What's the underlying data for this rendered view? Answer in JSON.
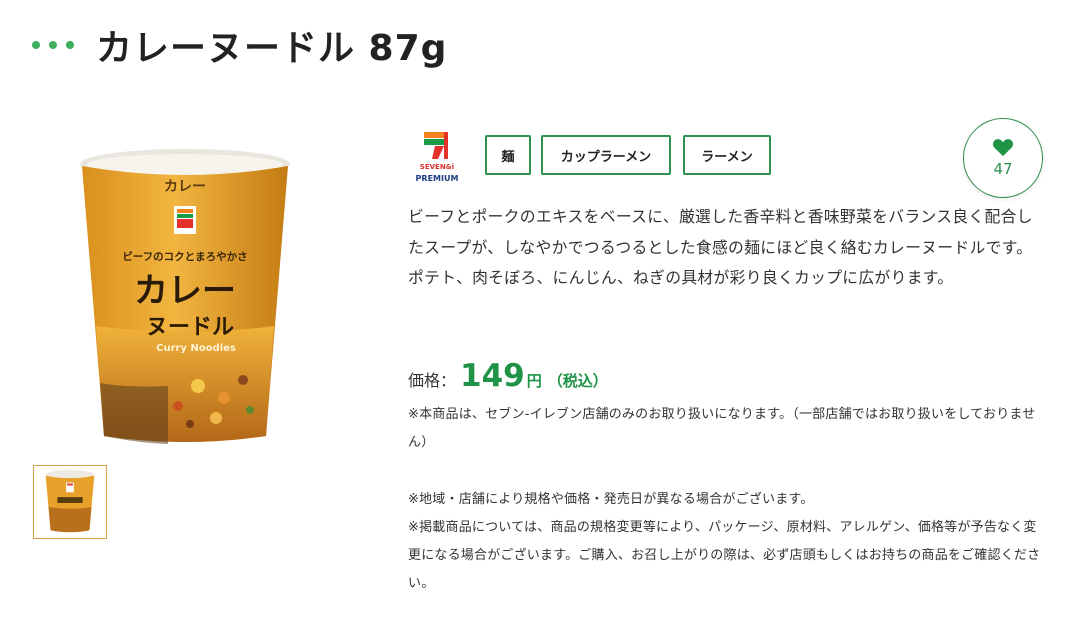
{
  "header": {
    "title": "カレーヌードル 87g"
  },
  "brand": {
    "logo_text_line1": "SEVEN&i",
    "logo_text_line2": "PREMIUM"
  },
  "tags": [
    {
      "label": "麺"
    },
    {
      "label": "カップラーメン"
    },
    {
      "label": "ラーメン"
    }
  ],
  "favorite": {
    "count": "47"
  },
  "description": "ビーフとポークのエキスをベースに、厳選した香辛料と香味野菜をバランス良く配合したスープが、しなやかでつるつるとした食感の麺にほど良く絡むカレーヌードルです。ポテト、肉そぼろ、にんじん、ねぎの具材が彩り良くカップに広がります。",
  "price": {
    "label": "価格：",
    "value": "149",
    "unit": "円",
    "tax": "（税込）"
  },
  "notes": {
    "store_only": "※本商品は、セブン-イレブン店舗のみのお取り扱いになります。（一部店舗ではお取り扱いをしておりません）",
    "region": "※地域・店舗により規格や価格・発売日が異なる場合がございます。",
    "listing": "※掲載商品については、商品の規格変更等により、パッケージ、原材料、アレルゲン、価格等が予告なく変更になる場合がございます。ご購入、お召し上がりの際は、必ず店頭もしくはお持ちの商品をご確認ください。"
  },
  "package": {
    "tagline": "ビーフのコクとまろやかさ",
    "name_line1": "カレー",
    "name_line2": "ヌードル",
    "english": "Curry Noodles"
  },
  "colors": {
    "accent_green": "#1f9346",
    "package_orange": "#e7a12a",
    "logo_red": "#e4312b"
  },
  "icons": {
    "title_marker": "three-dots-icon",
    "favorite": "heart-icon"
  }
}
